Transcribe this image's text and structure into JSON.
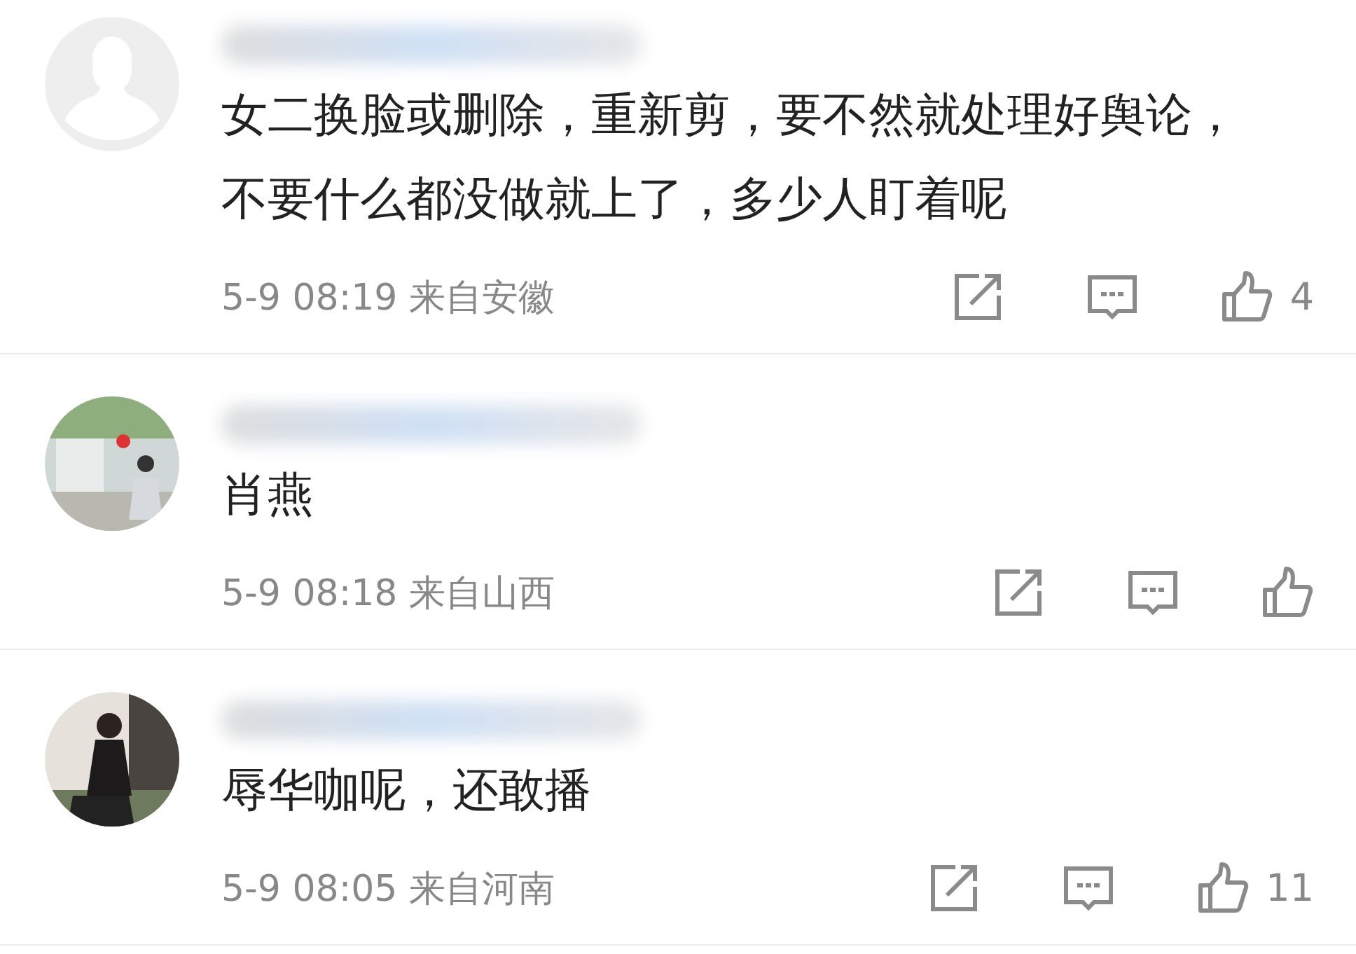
{
  "comments": [
    {
      "avatar": {
        "kind": "default"
      },
      "text": "女二换脸或删除，重新剪，要不然就处理好舆论，不要什么都没做就上了，多少人盯着呢",
      "time": "5-9 08:19",
      "location": "来自安徽",
      "likes": "4"
    },
    {
      "text": "肖燕",
      "time": "5-9 08:18",
      "location": "来自山西"
    },
    {
      "text": "辱华咖呢，还敢播",
      "time": "5-9 08:05",
      "location": "来自河南",
      "likes": "11"
    }
  ]
}
